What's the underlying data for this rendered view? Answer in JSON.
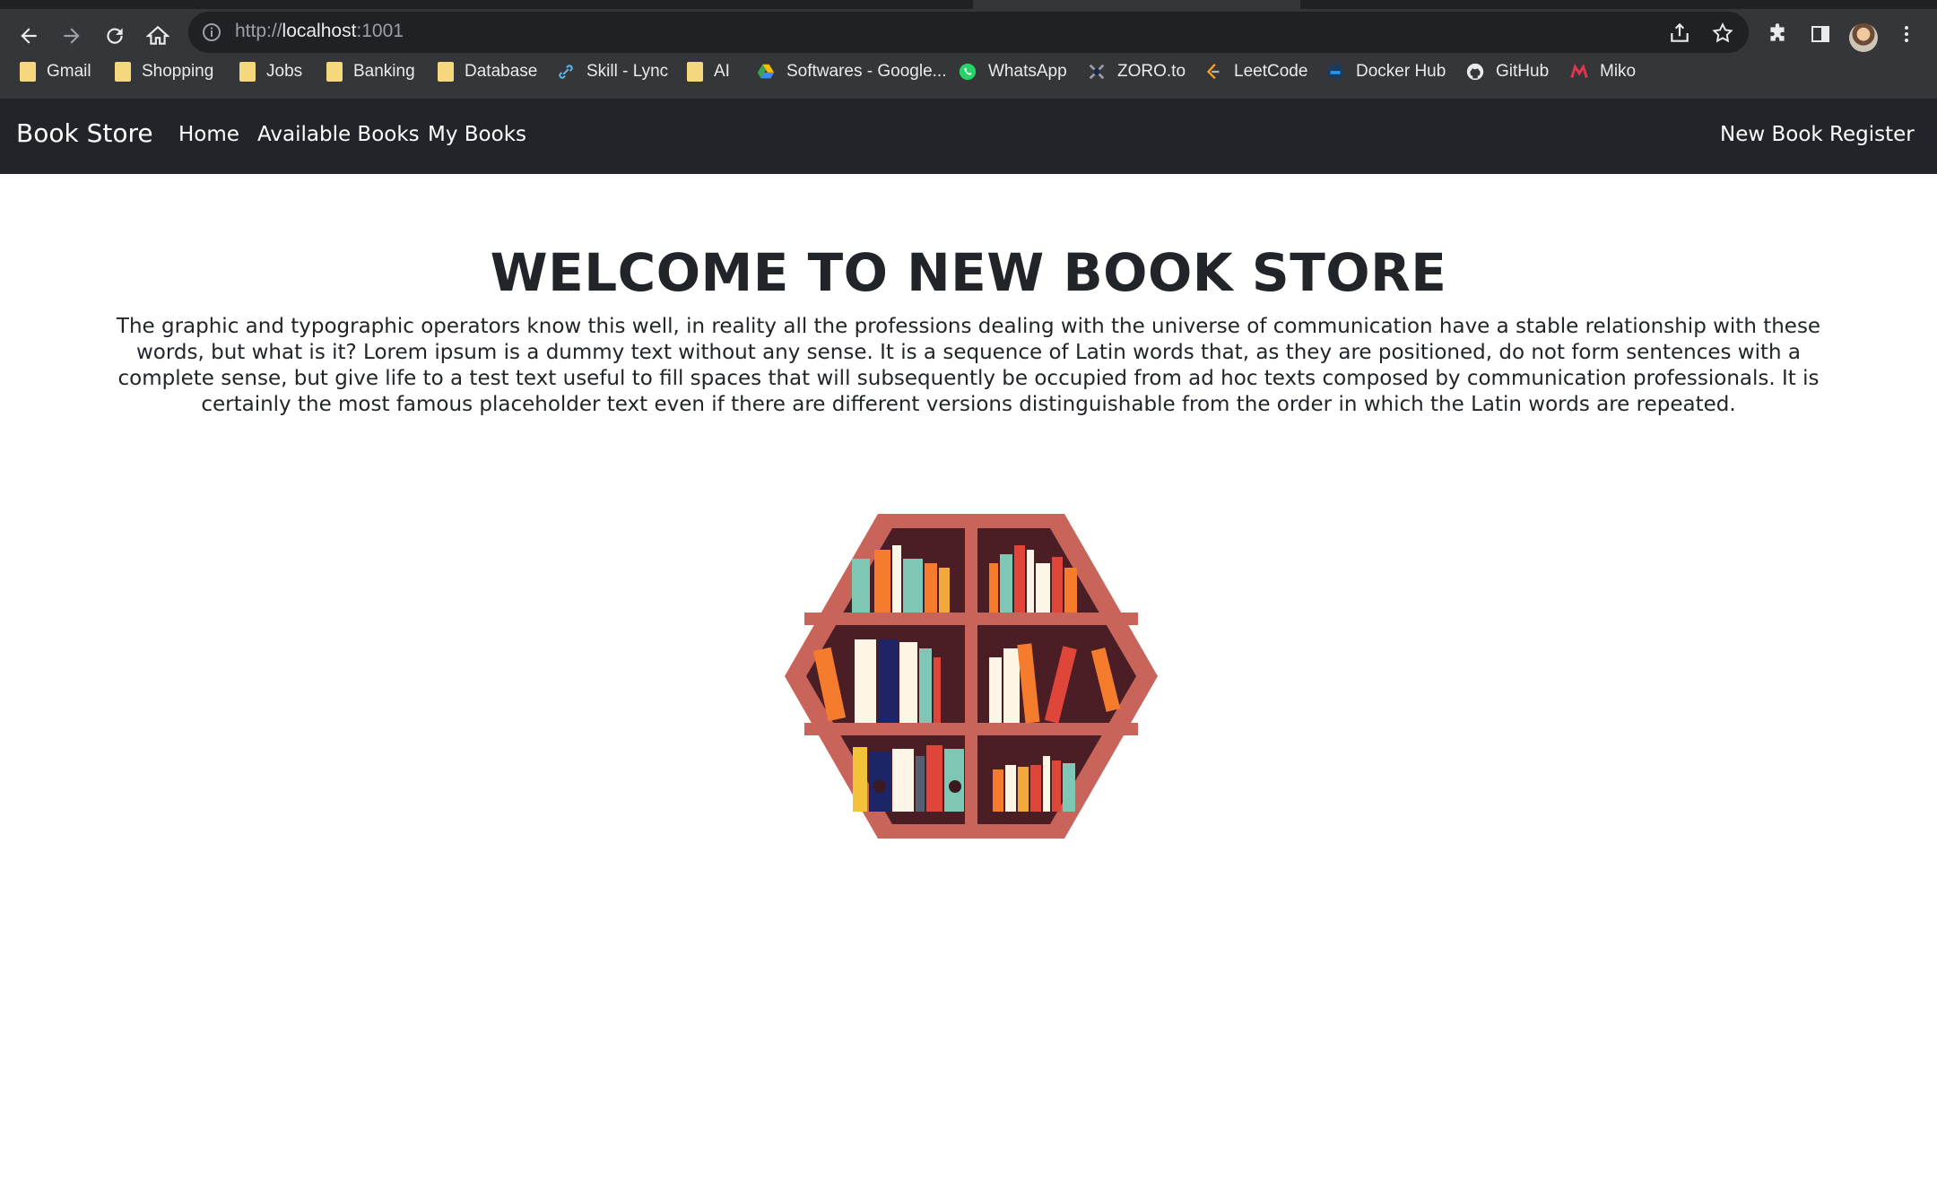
{
  "browser": {
    "url_scheme": "http://",
    "url_host": "localhost",
    "url_port": ":1001",
    "bookmarks": [
      {
        "label": "Gmail",
        "icon": "folder-icon"
      },
      {
        "label": "Shopping",
        "icon": "folder-icon"
      },
      {
        "label": "Jobs",
        "icon": "folder-icon"
      },
      {
        "label": "Banking",
        "icon": "folder-icon"
      },
      {
        "label": "Database",
        "icon": "folder-icon"
      },
      {
        "label": "Skill - Lync",
        "icon": "link-icon"
      },
      {
        "label": "AI",
        "icon": "folder-icon"
      },
      {
        "label": "Softwares - Google...",
        "icon": "google-drive-icon"
      },
      {
        "label": "WhatsApp",
        "icon": "whatsapp-icon"
      },
      {
        "label": "ZORO.to",
        "icon": "zoro-icon"
      },
      {
        "label": "LeetCode",
        "icon": "leetcode-icon"
      },
      {
        "label": "Docker Hub",
        "icon": "docker-icon"
      },
      {
        "label": "GitHub",
        "icon": "github-icon"
      },
      {
        "label": "Miko",
        "icon": "miko-icon"
      }
    ]
  },
  "navbar": {
    "brand": "Book Store",
    "links": [
      "Home",
      "Available Books",
      "My Books"
    ],
    "right_link": "New Book Register"
  },
  "main": {
    "title": "WELCOME TO NEW BOOK STORE",
    "description": "The graphic and typographic operators know this well, in reality all the professions dealing with the universe of communication have a stable relationship with these words, but what is it? Lorem ipsum is a dummy text without any sense. It is a sequence of Latin words that, as they are positioned, do not form sentences with a complete sense, but give life to a test text useful to fill spaces that will subsequently be occupied from ad hoc texts composed by communication professionals. It is certainly the most famous placeholder text even if there are different versions distinguishable from the order in which the Latin words are repeated."
  },
  "colors": {
    "navbar_bg": "#212529",
    "chrome_bg": "#35363a",
    "shelf_frame": "#c8645a",
    "shelf_back": "#4a1e24"
  }
}
